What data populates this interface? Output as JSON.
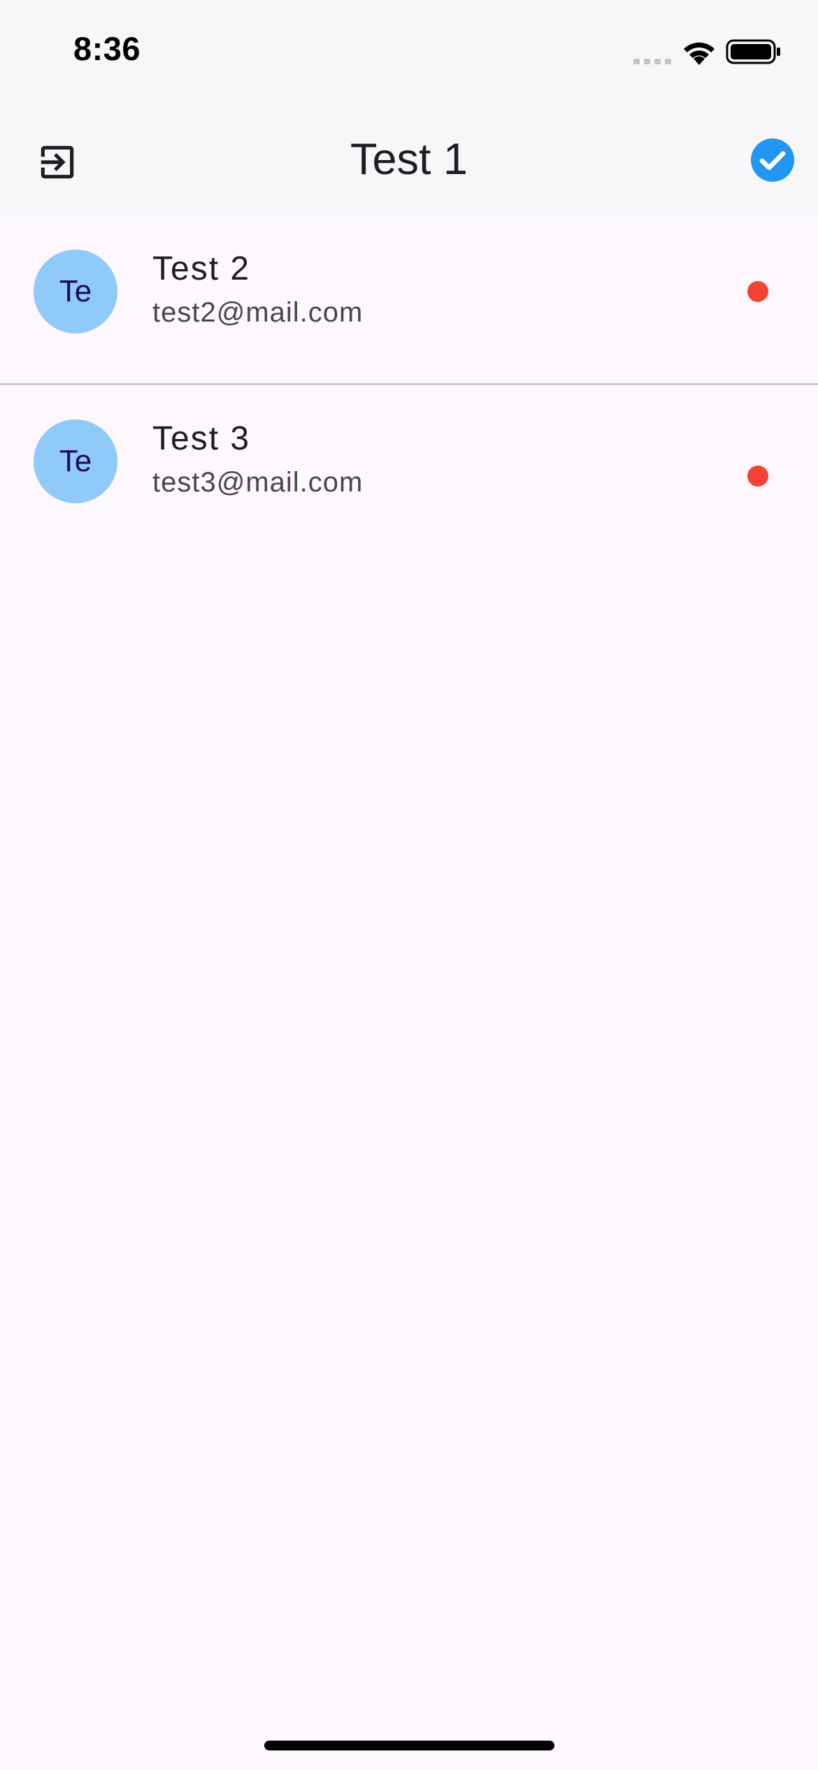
{
  "status_bar": {
    "time": "8:36"
  },
  "app_bar": {
    "title": "Test 1",
    "left_icon": "logout-icon",
    "right_icon": "check-circle-icon"
  },
  "users": [
    {
      "initials": "Te",
      "name": "Test 2",
      "email": "test2@mail.com",
      "status_color": "#f44336"
    },
    {
      "initials": "Te",
      "name": "Test 3",
      "email": "test3@mail.com",
      "status_color": "#f44336"
    }
  ],
  "colors": {
    "accent": "#2196f3",
    "avatar_bg": "#90caf9",
    "status_offline": "#f44336"
  }
}
